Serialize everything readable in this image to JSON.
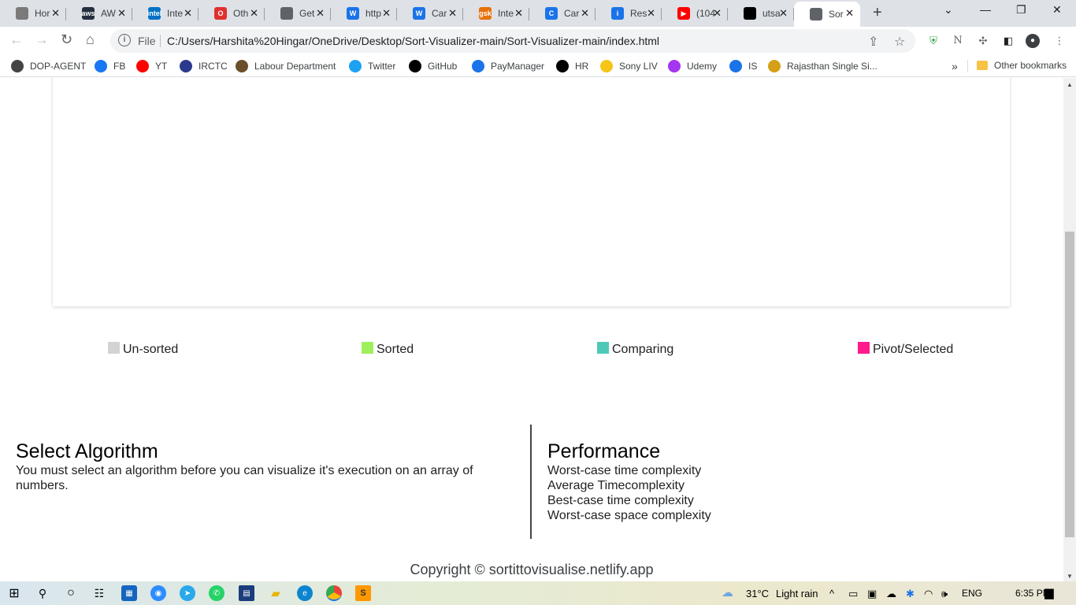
{
  "browser": {
    "tabs": [
      {
        "title": "Hor",
        "fav_color": "#7a7a7a",
        "fav_glyph": ""
      },
      {
        "title": "AW",
        "fav_color": "#232f3e",
        "fav_glyph": "aws"
      },
      {
        "title": "Inte",
        "fav_color": "#0071c5",
        "fav_glyph": "intel"
      },
      {
        "title": "Oth",
        "fav_color": "#e0312f",
        "fav_glyph": "O"
      },
      {
        "title": "Get",
        "fav_color": "#5f6368",
        "fav_glyph": ""
      },
      {
        "title": "http",
        "fav_color": "#1a73e8",
        "fav_glyph": "W"
      },
      {
        "title": "Car",
        "fav_color": "#1a73e8",
        "fav_glyph": "W"
      },
      {
        "title": "Inte",
        "fav_color": "#e8710a",
        "fav_glyph": "gsk"
      },
      {
        "title": "Car",
        "fav_color": "#1a73e8",
        "fav_glyph": "C"
      },
      {
        "title": "Res",
        "fav_color": "#1a73e8",
        "fav_glyph": "i"
      },
      {
        "title": "(104",
        "fav_color": "#ff0000",
        "fav_glyph": "▶"
      },
      {
        "title": "utsa",
        "fav_color": "#000000",
        "fav_glyph": ""
      },
      {
        "title": "Sor",
        "fav_color": "#5f6368",
        "fav_glyph": "",
        "active": true
      }
    ],
    "address": {
      "scheme_label": "File",
      "url": "C:/Users/Harshita%20Hingar/OneDrive/Desktop/Sort-Visualizer-main/Sort-Visualizer-main/index.html"
    },
    "bookmarks": [
      {
        "label": "DOP-AGENT",
        "color": "#444444"
      },
      {
        "label": "FB",
        "color": "#1877f2"
      },
      {
        "label": "YT",
        "color": "#ff0000"
      },
      {
        "label": "IRCTC",
        "color": "#2b3a8c"
      },
      {
        "label": "Labour Department",
        "color": "#6b4f2a"
      },
      {
        "label": "Twitter",
        "color": "#1da1f2"
      },
      {
        "label": "GitHub",
        "color": "#000000"
      },
      {
        "label": "PayManager",
        "color": "#1a73e8"
      },
      {
        "label": "HR",
        "color": "#000000"
      },
      {
        "label": "Sony LIV",
        "color": "#f5c518"
      },
      {
        "label": "Udemy",
        "color": "#a435f0"
      },
      {
        "label": "IS",
        "color": "#1a73e8"
      },
      {
        "label": "Rajasthan Single Si...",
        "color": "#d4a017"
      }
    ],
    "bookmarks_overflow": "»",
    "other_bookmarks": "Other bookmarks"
  },
  "page": {
    "legend": [
      {
        "label": "Un-sorted",
        "color": "#d3d3d3"
      },
      {
        "label": "Sorted",
        "color": "#9ff05a"
      },
      {
        "label": "Comparing",
        "color": "#4ec9b8"
      },
      {
        "label": "Pivot/Selected",
        "color": "#ff1a8c"
      }
    ],
    "algorithm": {
      "title": "Select Algorithm",
      "description": "You must select an algorithm before you can visualize it's execution on an array of numbers."
    },
    "performance": {
      "title": "Performance",
      "items": [
        "Worst-case time complexity",
        "Average Timecomplexity",
        "Best-case time complexity",
        "Worst-case space complexity"
      ]
    },
    "footer": "Copyright © sortittovisualise.netlify.app"
  },
  "taskbar": {
    "weather_temp": "31°C",
    "weather_desc": "Light rain",
    "language": "ENG",
    "time": "6:35 PM"
  }
}
